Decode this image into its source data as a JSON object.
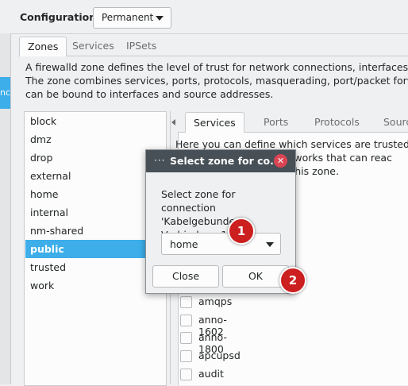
{
  "config": {
    "label": "Configuration:",
    "value": "Permanent"
  },
  "left_strip": {
    "selected_fragment": "nc"
  },
  "main_tabs": [
    {
      "label": "Zones"
    },
    {
      "label": "Services"
    },
    {
      "label": "IPSets"
    }
  ],
  "description": [
    "A firewalld zone defines the level of trust for network connections, interfaces and sourc",
    "The zone combines services, ports, protocols, masquerading, port/packet forwarding, ic",
    "can be bound to interfaces and source addresses."
  ],
  "zones": [
    "block",
    "dmz",
    "drop",
    "external",
    "home",
    "internal",
    "nm-shared",
    "public",
    "trusted",
    "work"
  ],
  "selected_zone": "public",
  "inner_tabs": [
    {
      "label": "Services"
    },
    {
      "label": "Ports"
    },
    {
      "label": "Protocols"
    },
    {
      "label": "Sourc"
    }
  ],
  "inner_description": [
    "Here you can define which services are trusted in the",
    "nd networks that can reac",
    "nd to this zone."
  ],
  "services": [
    "amqps",
    "anno-1602",
    "anno-1800",
    "apcupsd",
    "audit"
  ],
  "dialog": {
    "title": "Select zone for co...",
    "close_glyph": "✕",
    "menu_glyph": "···",
    "message": [
      "Select zone for connection",
      "'Kabelgebundene",
      "Verbindung 1'"
    ],
    "zone_value": "home",
    "close_button": "Close",
    "ok_button": "OK"
  },
  "markers": [
    {
      "label": "1"
    },
    {
      "label": "2"
    }
  ],
  "colors": {
    "accent": "#3daee9",
    "marker": "#cc1f1f",
    "title_bar": "#475057"
  }
}
